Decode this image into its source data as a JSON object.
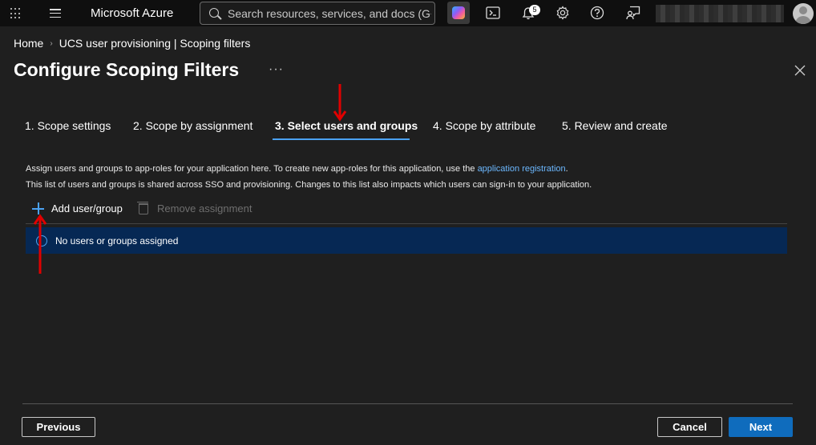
{
  "topbar": {
    "brand": "Microsoft Azure",
    "search_placeholder": "Search resources, services, and docs (G+/)",
    "notification_count": "5"
  },
  "breadcrumb": {
    "home": "Home",
    "current": "UCS user provisioning | Scoping filters"
  },
  "page": {
    "title": "Configure Scoping Filters",
    "more": "···"
  },
  "tabs": [
    {
      "label": "1. Scope settings"
    },
    {
      "label": "2. Scope by assignment"
    },
    {
      "label": "3. Select users and groups"
    },
    {
      "label": "4. Scope by attribute"
    },
    {
      "label": "5. Review and create"
    }
  ],
  "description": {
    "line1_prefix": "Assign users and groups to app-roles for your application here. To create new app-roles for this application, use the ",
    "line1_link": "application registration",
    "line1_suffix": ".",
    "line2": "This list of users and groups is shared across SSO and provisioning. Changes to this list also impacts which users can sign-in to your application."
  },
  "toolbar": {
    "add_label": "Add user/group",
    "remove_label": "Remove assignment"
  },
  "banner": {
    "text": "No users or groups assigned"
  },
  "footer": {
    "previous": "Previous",
    "cancel": "Cancel",
    "next": "Next"
  },
  "colors": {
    "accent": "#4ba2f2",
    "primary_button": "#0f6cbd",
    "banner": "#062854",
    "annotation_arrow": "#e00000"
  }
}
